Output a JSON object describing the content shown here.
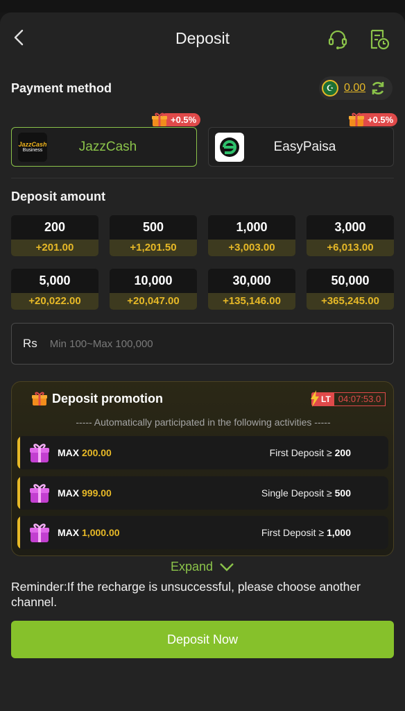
{
  "header": {
    "title": "Deposit"
  },
  "payment": {
    "label": "Payment method",
    "balance": "0.00",
    "methods": [
      {
        "name": "JazzCash",
        "bonus": "+0.5%",
        "logo_text": "JazzCash",
        "logo_sub": "Business"
      },
      {
        "name": "EasyPaisa",
        "bonus": "+0.5%"
      }
    ]
  },
  "amount": {
    "label": "Deposit amount",
    "options": [
      {
        "value": "200",
        "bonus": "+201.00"
      },
      {
        "value": "500",
        "bonus": "+1,201.50"
      },
      {
        "value": "1,000",
        "bonus": "+3,003.00"
      },
      {
        "value": "3,000",
        "bonus": "+6,013.00"
      },
      {
        "value": "5,000",
        "bonus": "+20,022.00"
      },
      {
        "value": "10,000",
        "bonus": "+20,047.00"
      },
      {
        "value": "30,000",
        "bonus": "+135,146.00"
      },
      {
        "value": "50,000",
        "bonus": "+365,245.00"
      }
    ],
    "currency": "Rs",
    "placeholder": "Min 100~Max 100,000"
  },
  "promotion": {
    "title": "Deposit promotion",
    "lt_label": "LT",
    "timer": "04:07:53.0",
    "subtitle": "----- Automatically participated in the following activities -----",
    "items": [
      {
        "max_label": "MAX",
        "max_value": "200.00",
        "condition": "First Deposit ≥",
        "threshold": "200"
      },
      {
        "max_label": "MAX",
        "max_value": "999.00",
        "condition": "Single Deposit ≥",
        "threshold": "500"
      },
      {
        "max_label": "MAX",
        "max_value": "1,000.00",
        "condition": "First Deposit ≥",
        "threshold": "1,000"
      }
    ],
    "expand_label": "Expand"
  },
  "reminder": "Reminder:If the recharge is unsuccessful, please choose another channel.",
  "submit_label": "Deposit Now",
  "colors": {
    "accent_green": "#86c12b",
    "gold": "#e7b927",
    "red": "#e04a4a",
    "background": "#232323"
  }
}
